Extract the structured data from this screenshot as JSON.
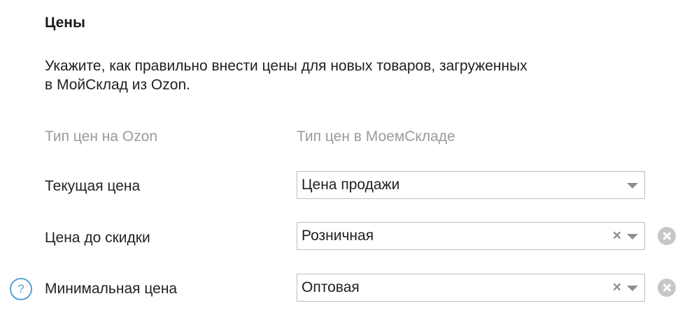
{
  "section": {
    "title": "Цены",
    "description_line1": "Укажите, как правильно внести цены для новых товаров, загруженных",
    "description_line2": "в МойСклад из Ozon."
  },
  "columns": {
    "ozon_header": "Тип цен на Ozon",
    "moysklad_header": "Тип цен в МоемСкладе"
  },
  "rows": [
    {
      "label": "Текущая цена",
      "selected": "Цена продажи",
      "clearable": false,
      "removable": false,
      "help": false
    },
    {
      "label": "Цена до скидки",
      "selected": "Розничная",
      "clearable": true,
      "removable": true,
      "help": false
    },
    {
      "label": "Минимальная цена",
      "selected": "Оптовая",
      "clearable": true,
      "removable": true,
      "help": true
    }
  ],
  "icons": {
    "help_glyph": "?",
    "clear_glyph": "×",
    "help_icon": "question-circle-icon",
    "clear_icon": "close-icon",
    "dropdown_icon": "chevron-down-icon",
    "remove_icon": "remove-circle-icon"
  },
  "colors": {
    "muted_text": "#9b9b9b",
    "help_accent": "#5aa2cf",
    "remove_gray": "#c7c7c7",
    "border": "#bdbdbd"
  }
}
